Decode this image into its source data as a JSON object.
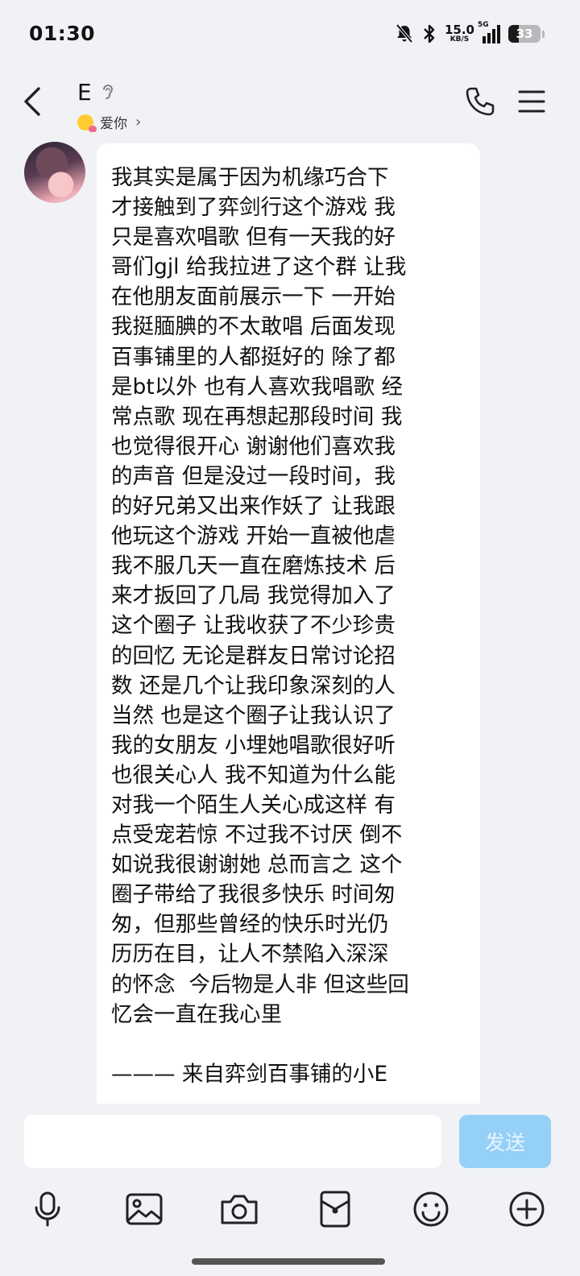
{
  "status_bar": {
    "time": "01:30",
    "net_speed_value": "15.0",
    "net_speed_unit": "KB/S",
    "network_type": "5G",
    "battery_level": "33"
  },
  "header": {
    "contact_name": "E",
    "status_text": "爱你",
    "status_chevron": "›"
  },
  "message": {
    "text": "我其实是属于因为机缘巧合下\n才接触到了弈剑行这个游戏 我\n只是喜欢唱歌 但有一天我的好\n哥们gjl 给我拉进了这个群 让我\n在他朋友面前展示一下 一开始\n我挺腼腆的不太敢唱 后面发现\n百事铺里的人都挺好的 除了都\n是bt以外 也有人喜欢我唱歌 经\n常点歌 现在再想起那段时间 我\n也觉得很开心 谢谢他们喜欢我\n的声音 但是没过一段时间，我\n的好兄弟又出来作妖了 让我跟\n他玩这个游戏 开始一直被他虐\n我不服几天一直在磨炼技术 后\n来才扳回了几局 我觉得加入了\n这个圈子 让我收获了不少珍贵\n的回忆 无论是群友日常讨论招\n数 还是几个让我印象深刻的人\n当然 也是这个圈子让我认识了\n我的女朋友 小埋她唱歌很好听\n也很关心人 我不知道为什么能\n对我一个陌生人关心成这样 有\n点受宠若惊 不过我不讨厌 倒不\n如说我很谢谢她 总而言之 这个\n圈子带给了我很多快乐 时间匆\n匆，但那些曾经的快乐时光仍\n历历在目，让人不禁陷入深深\n的怀念  今后物是人非 但这些回\n忆会一直在我心里\n\n——— 来自弈剑百事铺的小E"
  },
  "input": {
    "value": "",
    "placeholder": "",
    "send_label": "发送"
  },
  "toolbar": {
    "icons": [
      "microphone-icon",
      "image-icon",
      "camera-icon",
      "red-packet-icon",
      "emoji-icon",
      "plus-icon"
    ]
  },
  "colors": {
    "background": "#f1f2f6",
    "bubble": "#ffffff",
    "send_button": "#95d0f7",
    "send_text": "#e9f5fe"
  }
}
